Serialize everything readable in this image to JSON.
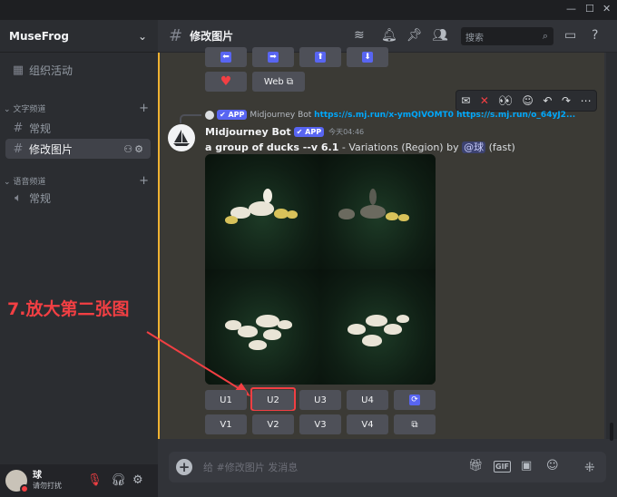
{
  "server": {
    "name": "MuseFrog"
  },
  "sidebar": {
    "events_label": "组织活动",
    "text_category": "文字频道",
    "voice_category": "语音频道",
    "text_channels": [
      "常规",
      "修改图片"
    ],
    "voice_channels": [
      "常规"
    ]
  },
  "user": {
    "name": "球",
    "status": "请勿打扰"
  },
  "header": {
    "channel": "修改图片",
    "search_placeholder": "搜索"
  },
  "prev_buttons": {
    "web_label": "Web"
  },
  "message": {
    "reply_author": "Midjourney Bot",
    "reply_links": "https://s.mj.run/x-ymQIVOMT0 https://s.mj.run/o_64yJ2...",
    "app_badge": "✔ APP",
    "author": "Midjourney Bot",
    "timestamp": "今天04:46",
    "prompt": "a group of ducks --v 6.1",
    "suffix": " - Variations (Region) by ",
    "mention": "@球",
    "speed": " (fast)"
  },
  "buttons": {
    "upscale": [
      "U1",
      "U2",
      "U3",
      "U4"
    ],
    "variation": [
      "V1",
      "V2",
      "V3",
      "V4"
    ]
  },
  "annotation": "7.放大第二张图",
  "input": {
    "placeholder": "给 #修改图片 发消息"
  },
  "colors": {
    "accent": "#5865f2",
    "annotation": "#f23f43",
    "mention_bar": "#f0b232"
  }
}
